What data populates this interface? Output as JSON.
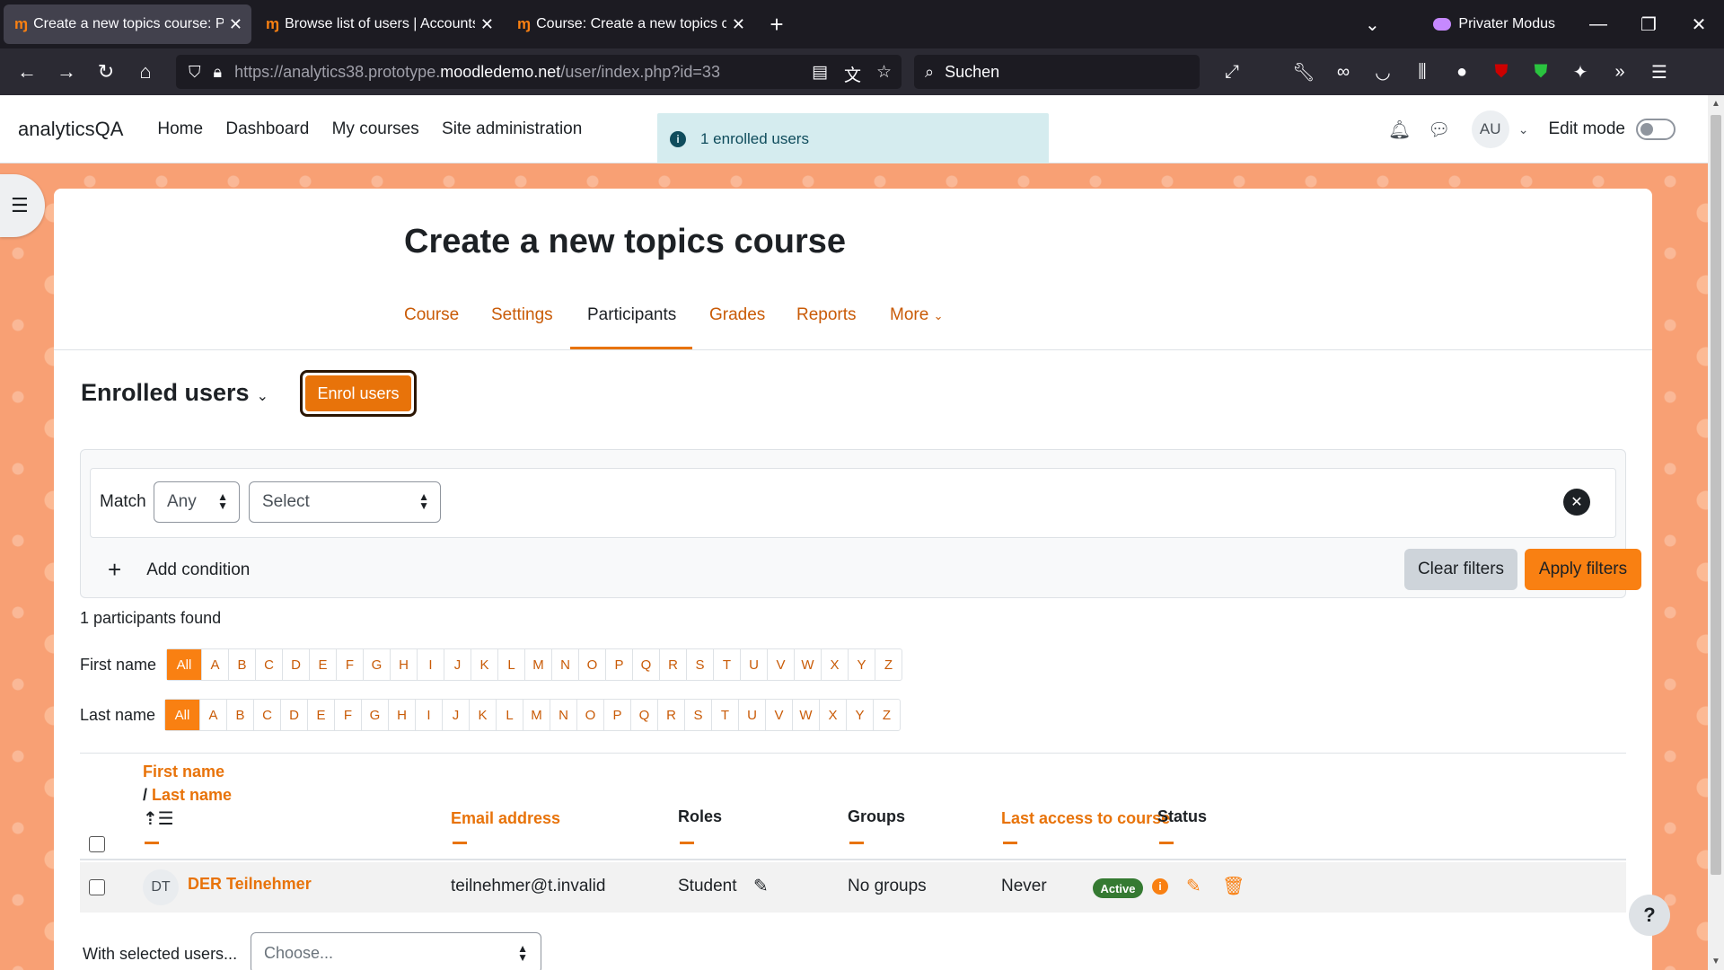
{
  "browser": {
    "tabs": [
      {
        "title": "Create a new topics course: Part",
        "active": true
      },
      {
        "title": "Browse list of users | Accounts |",
        "active": false
      },
      {
        "title": "Course: Create a new topics cou",
        "active": false
      }
    ],
    "private_label": "Privater Modus",
    "url": {
      "prefix": "https://analytics38.prototype.",
      "domain": "moodledemo.net",
      "path": "/user/index.php?id=33"
    },
    "search_placeholder": "Suchen"
  },
  "header": {
    "brand": "analyticsQA",
    "nav": [
      "Home",
      "Dashboard",
      "My courses",
      "Site administration"
    ],
    "toast": "1 enrolled users",
    "avatar_initials": "AU",
    "edit_mode_label": "Edit mode"
  },
  "course": {
    "title": "Create a new topics course",
    "tabs": [
      "Course",
      "Settings",
      "Participants",
      "Grades",
      "Reports",
      "More"
    ],
    "active_tab": "Participants"
  },
  "enrolled": {
    "heading": "Enrolled users",
    "enrol_button": "Enrol users"
  },
  "filters": {
    "match_label": "Match",
    "match_value": "Any",
    "type_value": "Select",
    "add_condition": "Add condition",
    "clear": "Clear filters",
    "apply": "Apply filters"
  },
  "participants_found": "1 participants found",
  "initials": {
    "first_name_label": "First name",
    "last_name_label": "Last name",
    "letters": [
      "All",
      "A",
      "B",
      "C",
      "D",
      "E",
      "F",
      "G",
      "H",
      "I",
      "J",
      "K",
      "L",
      "M",
      "N",
      "O",
      "P",
      "Q",
      "R",
      "S",
      "T",
      "U",
      "V",
      "W",
      "X",
      "Y",
      "Z"
    ]
  },
  "table": {
    "headers": {
      "first_name": "First name",
      "slash": "/ ",
      "last_name": "Last name",
      "email": "Email address",
      "roles": "Roles",
      "groups": "Groups",
      "last_access": "Last access to course",
      "status": "Status"
    },
    "rows": [
      {
        "initials": "DT",
        "name": "DER Teilnehmer",
        "email": "teilnehmer@t.invalid",
        "role": "Student",
        "groups": "No groups",
        "last_access": "Never",
        "status": "Active"
      }
    ]
  },
  "bulk": {
    "label": "With selected users...",
    "placeholder": "Choose..."
  },
  "help_label": "?",
  "colors": {
    "accent": "#f98012",
    "link": "#e8730a",
    "active_badge": "#357a32"
  }
}
